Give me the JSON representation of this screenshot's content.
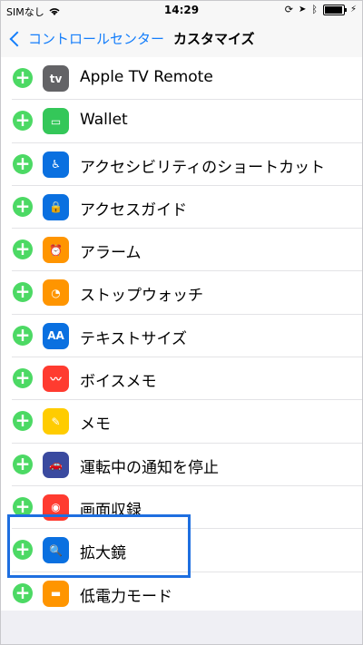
{
  "status_bar": {
    "carrier": "SIMなし",
    "time": "14:29",
    "battery_level": 0.85
  },
  "nav": {
    "back_label": "コントロールセンター",
    "title": "カスタマイズ"
  },
  "items": [
    {
      "label": "Apple TV Remote",
      "icon": "apple-tv-icon",
      "color": "#636366",
      "glyph": "tv"
    },
    {
      "label": "Wallet",
      "icon": "wallet-icon",
      "color": "#34c759",
      "glyph": "▭"
    },
    {
      "label": "アクセシビリティのショートカット",
      "icon": "accessibility-icon",
      "color": "#0a70e0",
      "glyph": "♿"
    },
    {
      "label": "アクセスガイド",
      "icon": "lock-icon",
      "color": "#0a70e0",
      "glyph": "🔒"
    },
    {
      "label": "アラーム",
      "icon": "alarm-icon",
      "color": "#ff9500",
      "glyph": "⏰"
    },
    {
      "label": "ストップウォッチ",
      "icon": "stopwatch-icon",
      "color": "#ff9500",
      "glyph": "◔"
    },
    {
      "label": "テキストサイズ",
      "icon": "text-size-icon",
      "color": "#0a70e0",
      "glyph": "AA"
    },
    {
      "label": "ボイスメモ",
      "icon": "voice-memo-icon",
      "color": "#ff3b30",
      "glyph": "〰"
    },
    {
      "label": "メモ",
      "icon": "notes-icon",
      "color": "#ffcc00",
      "glyph": "✎"
    },
    {
      "label": "運転中の通知を停止",
      "icon": "car-icon",
      "color": "#3a4a9f",
      "glyph": "🚗"
    },
    {
      "label": "画面収録",
      "icon": "record-icon",
      "color": "#ff3b30",
      "glyph": "◉"
    },
    {
      "label": "拡大鏡",
      "icon": "magnifier-icon",
      "color": "#0a70e0",
      "glyph": "🔍"
    },
    {
      "label": "低電力モード",
      "icon": "battery-icon",
      "color": "#ff9500",
      "glyph": "▬"
    }
  ],
  "add_glyph": "+",
  "highlight_color": "#1e6fe0"
}
